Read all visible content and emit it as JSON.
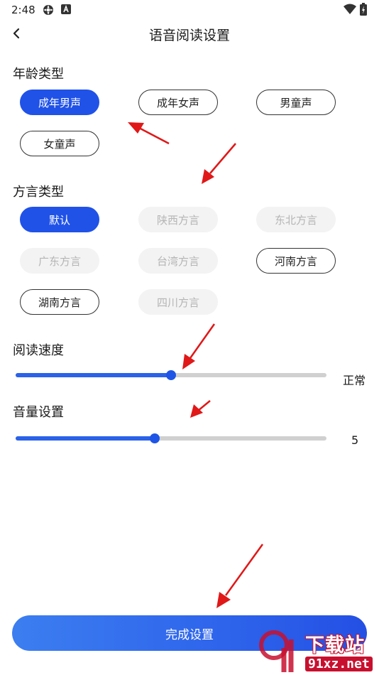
{
  "status_bar": {
    "time": "2:48",
    "icons": [
      "settings-icon",
      "notification-a-icon",
      "wifi-icon",
      "battery-icon"
    ]
  },
  "header": {
    "title": "语音阅读设置",
    "back_icon": "chevron-left-icon"
  },
  "age_type": {
    "title": "年龄类型",
    "options": [
      {
        "label": "成年男声",
        "state": "selected"
      },
      {
        "label": "成年女声",
        "state": "normal"
      },
      {
        "label": "男童声",
        "state": "normal"
      },
      {
        "label": "女童声",
        "state": "normal"
      }
    ]
  },
  "dialect_type": {
    "title": "方言类型",
    "options": [
      {
        "label": "默认",
        "state": "selected"
      },
      {
        "label": "陕西方言",
        "state": "disabled"
      },
      {
        "label": "东北方言",
        "state": "disabled"
      },
      {
        "label": "广东方言",
        "state": "disabled"
      },
      {
        "label": "台湾方言",
        "state": "disabled"
      },
      {
        "label": "河南方言",
        "state": "normal"
      },
      {
        "label": "湖南方言",
        "state": "normal"
      },
      {
        "label": "四川方言",
        "state": "disabled"
      }
    ]
  },
  "reading_speed": {
    "title": "阅读速度",
    "value_label": "正常",
    "level": 0.5
  },
  "volume": {
    "title": "音量设置",
    "value_label": "5",
    "level": 0.447
  },
  "done_button": {
    "label": "完成设置"
  },
  "annotation_color": "#e01818",
  "accent_color": "#2052e8",
  "watermark": {
    "top": "下载站",
    "bottom": "91xz.net"
  }
}
